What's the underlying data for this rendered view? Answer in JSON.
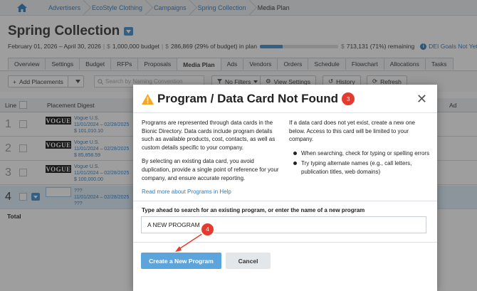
{
  "breadcrumbs": [
    "Advertisers",
    "EcoStyle Clothing",
    "Campaigns",
    "Spring Collection",
    "Media Plan"
  ],
  "page": {
    "title": "Spring Collection",
    "date_range": "February 01, 2026 – April 30, 2026",
    "budget": "1,000,000 budget",
    "in_plan": "286,869 (29% of budget) in plan",
    "in_plan_fraction": 0.29,
    "remaining": "713,131 (71%) remaining",
    "dei_link": "DEI Goals Not Yet"
  },
  "tabs": [
    "Overview",
    "Settings",
    "Budget",
    "RFPs",
    "Proposals",
    "Media Plan",
    "Ads",
    "Vendors",
    "Orders",
    "Schedule",
    "Flowchart",
    "Allocations",
    "Tasks"
  ],
  "active_tab": "Media Plan",
  "toolbar": {
    "add_placements": "Add Placements",
    "search_placeholder": "Search by Naming Convention",
    "no_filters": "No Filters",
    "view_settings": "View Settings",
    "history": "History",
    "refresh": "Refresh"
  },
  "grid": {
    "col_line": "Line",
    "col_digest": "Placement Digest",
    "col_ad": "Ad",
    "total_label": "Total",
    "rows": [
      {
        "num": "1",
        "logo": "VOGUE",
        "vendor": "Vogue U.S.",
        "dates": "11/01/2024 – 02/28/2025",
        "amount": "$ 101,010.10"
      },
      {
        "num": "2",
        "logo": "VOGUE",
        "vendor": "Vogue U.S.",
        "dates": "11/01/2024 – 02/28/2025",
        "amount": "$ 85,858.59"
      },
      {
        "num": "3",
        "logo": "VOGUE",
        "vendor": "Vogue U.S.",
        "dates": "11/01/2024 – 02/28/2025",
        "amount": "$ 100,000.00"
      },
      {
        "num": "4",
        "logo": "",
        "vendor": "???",
        "dates": "11/01/2024 – 02/28/2025",
        "amount": "???"
      }
    ]
  },
  "modal": {
    "title": "Program / Data Card Not Found",
    "step_badge": "3",
    "left_p1": "Programs are represented through data cards in the Bionic Directory. Data cards include program details such as available products, cost, contacts, as well as custom details specific to your company.",
    "left_p2": "By selecting an existing data card, you avoid duplication, provide a single point of reference for your company, and ensure accurate reporting.",
    "read_more": "Read more about Programs in Help",
    "right_p1": "If a data card does not yet exist, create a new one below. Access to this card will be limited to your company.",
    "bullet_1": "When searching, check for typing or spelling errors",
    "bullet_2": "Try typing alternate names (e.g., call letters, publication titles, web domains)",
    "input_label": "Type ahead to search for an existing program, or enter the name of a new program",
    "input_value": "A NEW PROGRAM",
    "create_button": "Create a New Program",
    "cancel_button": "Cancel",
    "step_badge_2": "4"
  },
  "colors": {
    "accent": "#3d8fd1",
    "badge": "#e53b2e",
    "primary_button": "#5ba4dc"
  }
}
